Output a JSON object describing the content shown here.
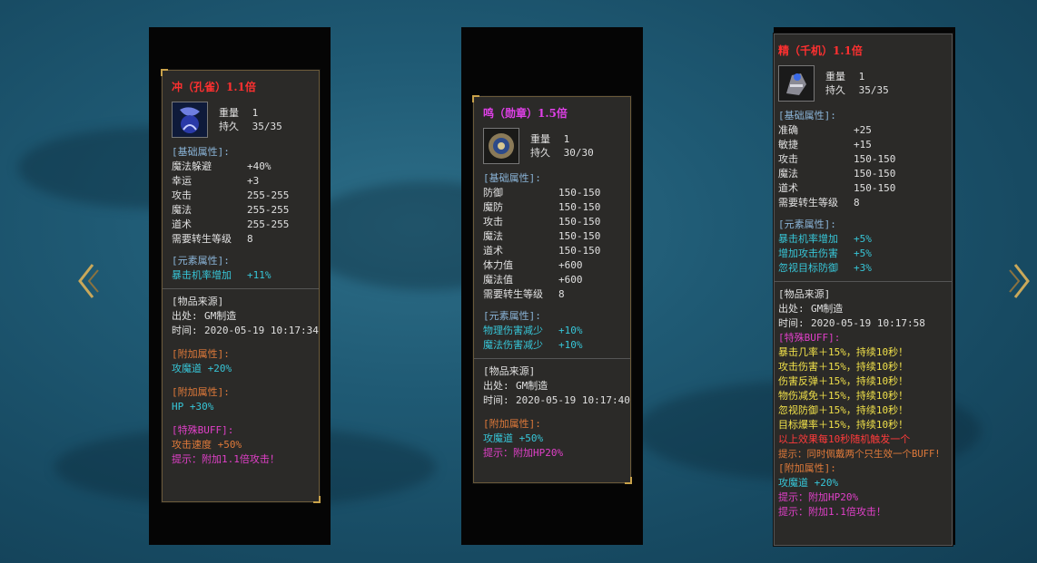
{
  "card1": {
    "title": "冲（孔雀）1.1倍",
    "weight_label": "重量",
    "weight": "1",
    "dur_label": "持久",
    "dur": "35/35",
    "base_header": "[基础属性]:",
    "base": [
      {
        "label": "魔法躲避",
        "value": "+40%"
      },
      {
        "label": "幸运",
        "value": "+3"
      },
      {
        "label": "攻击",
        "value": "255-255"
      },
      {
        "label": "魔法",
        "value": "255-255"
      },
      {
        "label": "道术",
        "value": "255-255"
      },
      {
        "label": "需要转生等级",
        "value": "8"
      }
    ],
    "elem_header": "[元素属性]:",
    "elem": [
      {
        "label": "暴击机率增加",
        "value": "+11%"
      }
    ],
    "source_header": "[物品来源]",
    "origin_label": "出处:",
    "origin": "GM制造",
    "time_label": "时间:",
    "time": "2020-05-19 10:17:34",
    "extra1_header": "[附加属性]:",
    "extra1": "攻魔道 +20%",
    "extra2_header": "[附加属性]:",
    "extra2": "HP +30%",
    "buff_header": "[特殊BUFF]:",
    "buff1": "攻击速度 +50%",
    "buff2": "提示：附加1.1倍攻击！"
  },
  "card2": {
    "title": "鸣（勋章）1.5倍",
    "weight_label": "重量",
    "weight": "1",
    "dur_label": "持久",
    "dur": "30/30",
    "base_header": "[基础属性]:",
    "base": [
      {
        "label": "防御",
        "value": "150-150"
      },
      {
        "label": "魔防",
        "value": "150-150"
      },
      {
        "label": "攻击",
        "value": "150-150"
      },
      {
        "label": "魔法",
        "value": "150-150"
      },
      {
        "label": "道术",
        "value": "150-150"
      },
      {
        "label": "体力值",
        "value": "+600"
      },
      {
        "label": "魔法值",
        "value": "+600"
      },
      {
        "label": "需要转生等级",
        "value": "8"
      }
    ],
    "elem_header": "[元素属性]:",
    "elem": [
      {
        "label": "物理伤害减少",
        "value": "+10%"
      },
      {
        "label": "魔法伤害减少",
        "value": "+10%"
      }
    ],
    "source_header": "[物品来源]",
    "origin_label": "出处:",
    "origin": "GM制造",
    "time_label": "时间:",
    "time": "2020-05-19 10:17:40",
    "extra_header": "[附加属性]:",
    "extra1": "攻魔道 +50%",
    "extra2": "提示：附加HP20%"
  },
  "card3": {
    "title": "精（千机）1.1倍",
    "weight_label": "重量",
    "weight": "1",
    "dur_label": "持久",
    "dur": "35/35",
    "base_header": "[基础属性]:",
    "base": [
      {
        "label": "准确",
        "value": "+25"
      },
      {
        "label": "敏捷",
        "value": "+15"
      },
      {
        "label": "攻击",
        "value": "150-150"
      },
      {
        "label": "魔法",
        "value": "150-150"
      },
      {
        "label": "道术",
        "value": "150-150"
      },
      {
        "label": "需要转生等级",
        "value": "8"
      }
    ],
    "elem_header": "[元素属性]:",
    "elem": [
      {
        "label": "暴击机率增加",
        "value": "+5%"
      },
      {
        "label": "增加攻击伤害",
        "value": "+5%"
      },
      {
        "label": "忽视目标防御",
        "value": "+3%"
      }
    ],
    "source_header": "[物品来源]",
    "origin_label": "出处:",
    "origin": "GM制造",
    "time_label": "时间:",
    "time": "2020-05-19 10:17:58",
    "buff_header": "[特殊BUFF]:",
    "buffs": [
      "暴击几率＋15%，持续10秒！",
      "攻击伤害＋15%，持续10秒！",
      "伤害反弹＋15%，持续10秒！",
      "物伤减免＋15%，持续10秒！",
      "忽视防御＋15%，持续10秒！",
      "目标爆率＋15%，持续10秒！"
    ],
    "buff_note1": "以上效果每10秒随机触发一个",
    "buff_note2": "提示：同时佩戴两个只生效一个BUFF!",
    "extra_header": "[附加属性]:",
    "extra1": "攻魔道 +20%",
    "extra2": "提示：附加HP20%",
    "extra3": "提示：附加1.1倍攻击！"
  },
  "colors": {
    "card1_title": "#ff3030",
    "card2_title": "#e040e8",
    "card3_title": "#ff3030"
  }
}
